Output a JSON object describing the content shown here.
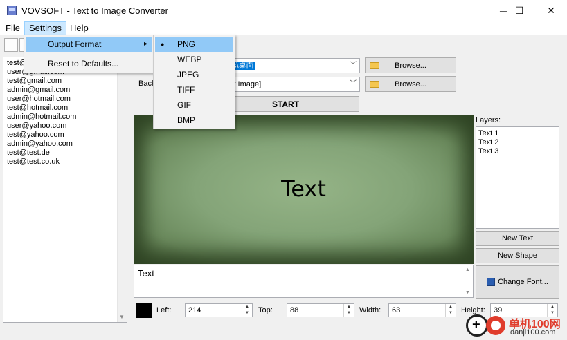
{
  "window": {
    "title": "VOVSOFT - Text to Image Converter",
    "minimize_glyph": "─",
    "maximize_glyph": "☐",
    "close_glyph": "✕"
  },
  "menubar": {
    "file": "File",
    "settings": "Settings",
    "help": "Help"
  },
  "settings_menu": {
    "output_format": "Output Format",
    "reset": "Reset to Defaults...",
    "submenu_arrow": "▸"
  },
  "output_format_menu": {
    "selected_index": 0,
    "selected_mark": "●",
    "options": [
      "PNG",
      "WEBP",
      "JPEG",
      "TIFF",
      "GIF",
      "BMP"
    ]
  },
  "email_list": [
    "test@gmail.com",
    "user@gmail.com",
    "test@gmail.com",
    "admin@gmail.com",
    "user@hotmail.com",
    "test@hotmail.com",
    "admin@hotmail.com",
    "user@yahoo.com",
    "test@yahoo.com",
    "admin@yahoo.com",
    "test@test.de",
    "test@test.co.uk"
  ],
  "output_row": {
    "path_tail": "s\\桌面",
    "browse_label": "Browse..."
  },
  "background_row": {
    "label_partial": "Back",
    "value_tail": "lt Image]",
    "browse_label": "Browse..."
  },
  "start_button": "START",
  "preview": {
    "text": "Text"
  },
  "layers": {
    "label": "Layers:",
    "items": [
      "Text 1",
      "Text 2",
      "Text 3"
    ]
  },
  "buttons": {
    "new_text": "New Text",
    "new_shape": "New Shape",
    "change_font": "Change Font..."
  },
  "text_input": {
    "value": "Text"
  },
  "position": {
    "color_hex": "#000000",
    "left_label": "Left:",
    "left_value": "214",
    "top_label": "Top:",
    "top_value": "88",
    "width_label": "Width:",
    "width_value": "63",
    "height_label": "Height:",
    "height_value": "39"
  },
  "watermark": {
    "cn": "单机100网",
    "url": "danji100.com"
  }
}
